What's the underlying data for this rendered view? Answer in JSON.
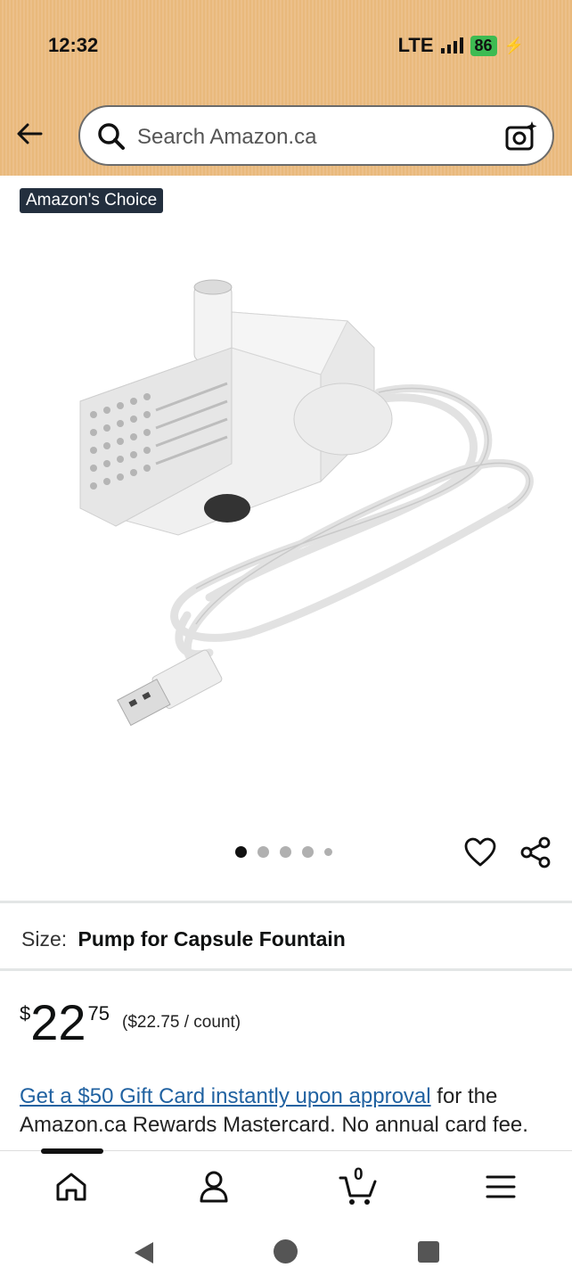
{
  "status_bar": {
    "time": "12:32",
    "network": "LTE",
    "battery": "86"
  },
  "search": {
    "placeholder": "Search Amazon.ca"
  },
  "badge": "Amazon's Choice",
  "product": {
    "image_alt": "USB submersible pump with cable",
    "carousel": {
      "total": 5,
      "active": 1
    }
  },
  "size": {
    "label": "Size:",
    "value": "Pump for Capsule Fountain"
  },
  "price": {
    "symbol": "$",
    "whole": "22",
    "fraction": "75",
    "unit": "($22.75 / count)"
  },
  "promo": {
    "link": "Get a $50 Gift Card instantly upon approval",
    "text": " for the Amazon.ca Rewards Mastercard. No annual card fee."
  },
  "bottom_nav": {
    "cart_count": "0"
  },
  "icons": [
    "back-arrow-icon",
    "search-icon",
    "camera-icon",
    "heart-icon",
    "share-icon",
    "home-icon",
    "account-icon",
    "cart-icon",
    "menu-icon"
  ]
}
